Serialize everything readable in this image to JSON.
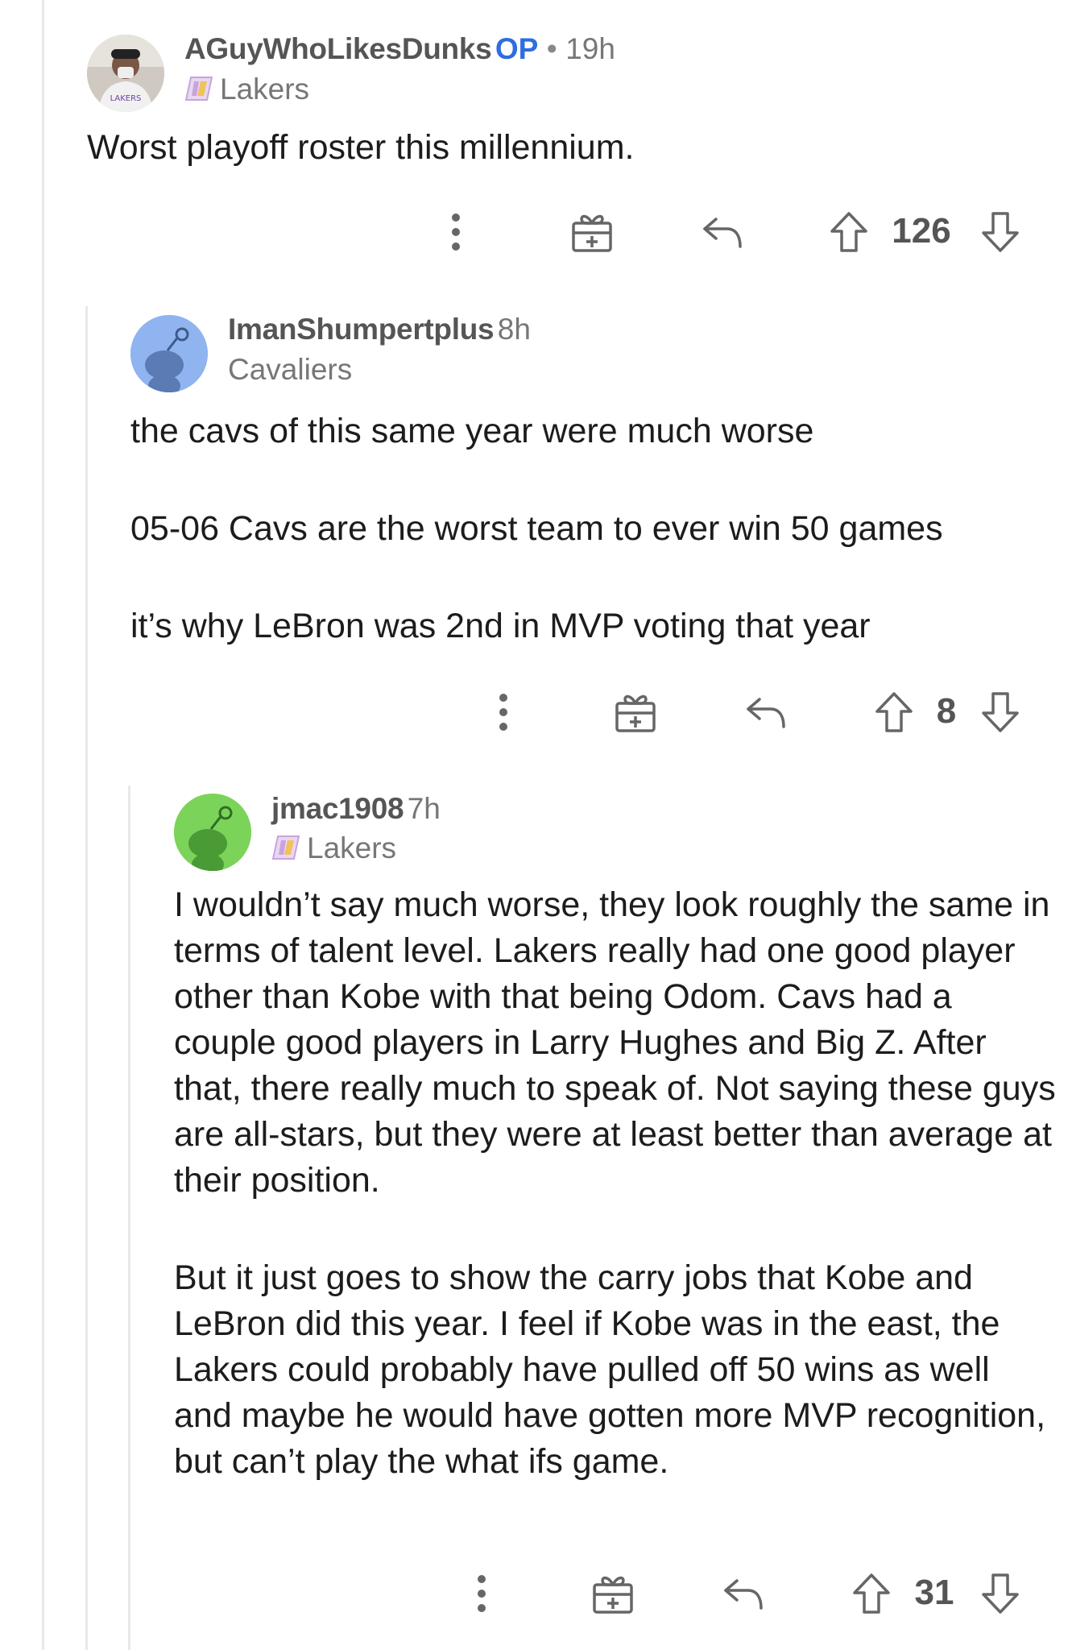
{
  "comments": [
    {
      "username": "AGuyWhoLikesDunks",
      "op_badge": "OP",
      "separator": "•",
      "time": "19h",
      "flair": "Lakers",
      "body": [
        "Worst playoff roster this millennium."
      ],
      "score": "126",
      "avatar": "user-photo"
    },
    {
      "username": "ImanShumpertplus",
      "time": "8h",
      "flair": "Cavaliers",
      "body": [
        "the cavs of this same year were much worse",
        "05-06 Cavs are the worst team to ever win 50 games",
        "it’s why LeBron was 2nd in MVP voting that year"
      ],
      "score": "8",
      "avatar": "snoo-blue"
    },
    {
      "username": "jmac1908",
      "time": "7h",
      "flair": "Lakers",
      "body": [
        "I wouldn’t say much worse, they look roughly the same in terms of talent level. Lakers really had one good player other than Kobe with that being Odom. Cavs had a couple good players in Larry Hughes and Big Z. After that, there really much to speak of. Not saying these guys are all-stars, but they were at least better than average at their position.",
        "But it just goes to show the carry jobs that Kobe and LeBron did this year. I feel if Kobe was in the east, the Lakers could probably have pulled off 50 wins as well and maybe he would have gotten more MVP recognition, but can’t play the what ifs game."
      ],
      "score": "31",
      "avatar": "snoo-green"
    }
  ],
  "icons": {
    "more": "more-options-icon",
    "award": "award-gift-icon",
    "reply": "reply-arrow-icon",
    "upvote": "upvote-arrow-icon",
    "downvote": "downvote-arrow-icon",
    "flair": "lakers-flair-icon"
  },
  "colors": {
    "op_badge": "#2e6ee0",
    "snoo_blue_bg": "#8fb4f0",
    "snoo_green_bg": "#7cd35a",
    "lakers_flair": "#c9a3e0"
  }
}
